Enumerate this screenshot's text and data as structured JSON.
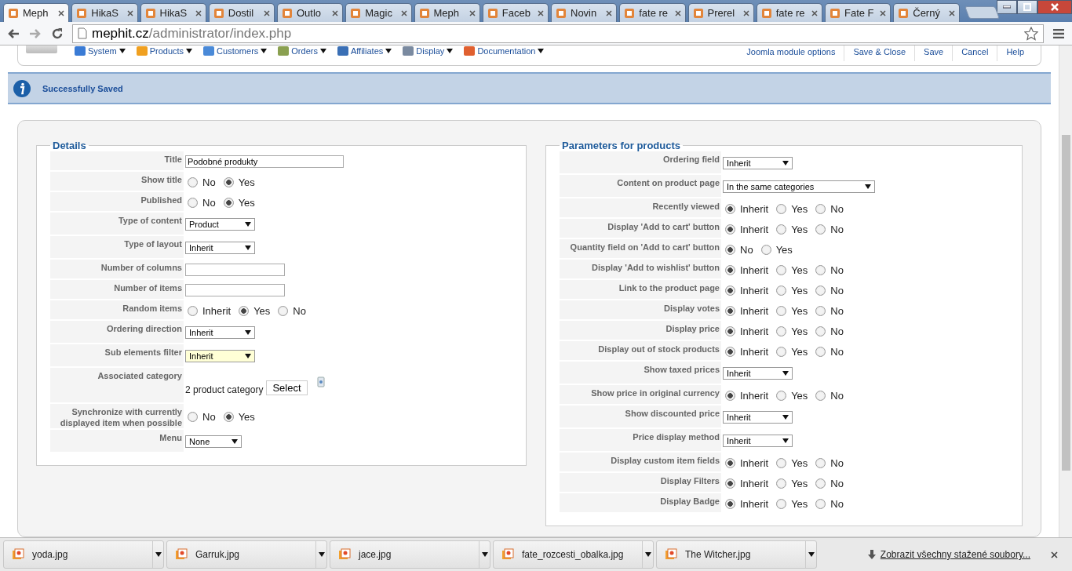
{
  "browser": {
    "tabs": [
      {
        "title": "Meph",
        "selected": true
      },
      {
        "title": "HikaS",
        "selected": false
      },
      {
        "title": "HikaS",
        "selected": false
      },
      {
        "title": "Dostil",
        "selected": false
      },
      {
        "title": "Outlo",
        "selected": false
      },
      {
        "title": "Magic",
        "selected": false
      },
      {
        "title": "Meph",
        "selected": false
      },
      {
        "title": "Faceb",
        "selected": false
      },
      {
        "title": "Novin",
        "selected": false
      },
      {
        "title": "fate re",
        "selected": false
      },
      {
        "title": "Prerel",
        "selected": false
      },
      {
        "title": "fate re",
        "selected": false
      },
      {
        "title": "Fate F",
        "selected": false
      },
      {
        "title": "Černý",
        "selected": false
      }
    ],
    "url_host": "mephit.cz",
    "url_path": "/administrator/index.php"
  },
  "menu": [
    "System",
    "Products",
    "Customers",
    "Orders",
    "Affiliates",
    "Display",
    "Documentation"
  ],
  "actions": [
    "Joomla module options",
    "Save & Close",
    "Save",
    "Cancel",
    "Help"
  ],
  "message": "Successfully Saved",
  "details": {
    "legend": "Details",
    "rows": [
      {
        "label": "Title",
        "kind": "text",
        "value": "Podobné produkty"
      },
      {
        "label": "Show title",
        "kind": "radio",
        "options": [
          {
            "label": "No",
            "selected": false
          },
          {
            "label": "Yes",
            "selected": true
          }
        ]
      },
      {
        "label": "Published",
        "kind": "radio",
        "options": [
          {
            "label": "No",
            "selected": false
          },
          {
            "label": "Yes",
            "selected": true
          }
        ]
      },
      {
        "label": "Type of content",
        "kind": "select",
        "value": "Product",
        "highlighted": false
      },
      {
        "label": "Type of layout",
        "kind": "select",
        "value": "Inherit",
        "highlighted": false
      },
      {
        "label": "Number of columns",
        "kind": "text"
      },
      {
        "label": "Number of items",
        "kind": "text"
      },
      {
        "label": "Random items",
        "kind": "radio",
        "options": [
          {
            "label": "Inherit",
            "selected": false
          },
          {
            "label": "Yes",
            "selected": true
          },
          {
            "label": "No",
            "selected": false
          }
        ]
      },
      {
        "label": "Ordering direction",
        "kind": "select",
        "value": "Inherit",
        "highlighted": false
      },
      {
        "label": "Sub elements filter",
        "kind": "select",
        "value": "Inherit",
        "highlighted": true
      },
      {
        "label": "Associated category",
        "kind": "category",
        "value": "2 product category",
        "button": "Select"
      },
      {
        "label": "Synchronize with currently displayed item when possible",
        "kind": "radio",
        "options": [
          {
            "label": "No",
            "selected": false
          },
          {
            "label": "Yes",
            "selected": true
          }
        ]
      },
      {
        "label": "Menu",
        "kind": "select",
        "value": "None",
        "highlighted": false
      }
    ]
  },
  "parameters": {
    "legend": "Parameters for products",
    "rows": [
      {
        "label": "Ordering field",
        "kind": "select",
        "value": "Inherit",
        "highlighted": false
      },
      {
        "label": "Content on product page",
        "kind": "select",
        "value": "In the same categories",
        "highlighted": false
      },
      {
        "label": "Recently viewed",
        "kind": "radio",
        "options": [
          {
            "label": "Inherit",
            "selected": true
          },
          {
            "label": "Yes",
            "selected": false
          },
          {
            "label": "No",
            "selected": false
          }
        ]
      },
      {
        "label": "Display 'Add to cart' button",
        "kind": "radio",
        "options": [
          {
            "label": "Inherit",
            "selected": true
          },
          {
            "label": "Yes",
            "selected": false
          },
          {
            "label": "No",
            "selected": false
          }
        ]
      },
      {
        "label": "Quantity field on 'Add to cart' button",
        "kind": "radio",
        "options": [
          {
            "label": "No",
            "selected": true
          },
          {
            "label": "Yes",
            "selected": false
          }
        ]
      },
      {
        "label": "Display 'Add to wishlist' button",
        "kind": "radio",
        "options": [
          {
            "label": "Inherit",
            "selected": true
          },
          {
            "label": "Yes",
            "selected": false
          },
          {
            "label": "No",
            "selected": false
          }
        ]
      },
      {
        "label": "Link to the product page",
        "kind": "radio",
        "options": [
          {
            "label": "Inherit",
            "selected": true
          },
          {
            "label": "Yes",
            "selected": false
          },
          {
            "label": "No",
            "selected": false
          }
        ]
      },
      {
        "label": "Display votes",
        "kind": "radio",
        "options": [
          {
            "label": "Inherit",
            "selected": true
          },
          {
            "label": "Yes",
            "selected": false
          },
          {
            "label": "No",
            "selected": false
          }
        ]
      },
      {
        "label": "Display price",
        "kind": "radio",
        "options": [
          {
            "label": "Inherit",
            "selected": true
          },
          {
            "label": "Yes",
            "selected": false
          },
          {
            "label": "No",
            "selected": false
          }
        ]
      },
      {
        "label": "Display out of stock products",
        "kind": "radio",
        "options": [
          {
            "label": "Inherit",
            "selected": true
          },
          {
            "label": "Yes",
            "selected": false
          },
          {
            "label": "No",
            "selected": false
          }
        ]
      },
      {
        "label": "Show taxed prices",
        "kind": "select",
        "value": "Inherit",
        "highlighted": false
      },
      {
        "label": "Show price in original currency",
        "kind": "radio",
        "options": [
          {
            "label": "Inherit",
            "selected": true
          },
          {
            "label": "Yes",
            "selected": false
          },
          {
            "label": "No",
            "selected": false
          }
        ]
      },
      {
        "label": "Show discounted price",
        "kind": "select",
        "value": "Inherit",
        "highlighted": false
      },
      {
        "label": "Price display method",
        "kind": "select",
        "value": "Inherit",
        "highlighted": false
      },
      {
        "label": "Display custom item fields",
        "kind": "radio",
        "options": [
          {
            "label": "Inherit",
            "selected": true
          },
          {
            "label": "Yes",
            "selected": false
          },
          {
            "label": "No",
            "selected": false
          }
        ]
      },
      {
        "label": "Display Filters",
        "kind": "radio",
        "options": [
          {
            "label": "Inherit",
            "selected": true
          },
          {
            "label": "Yes",
            "selected": false
          },
          {
            "label": "No",
            "selected": false
          }
        ]
      },
      {
        "label": "Display Badge",
        "kind": "radio",
        "options": [
          {
            "label": "Inherit",
            "selected": true
          },
          {
            "label": "Yes",
            "selected": false
          },
          {
            "label": "No",
            "selected": false
          }
        ]
      }
    ]
  },
  "downloads": {
    "files": [
      "yoda.jpg",
      "Garruk.jpg",
      "jace.jpg",
      "fate_rozcesti_obalka.jpg",
      "The Witcher.jpg"
    ],
    "show_all": "Zobrazit všechny stažené soubory..."
  }
}
